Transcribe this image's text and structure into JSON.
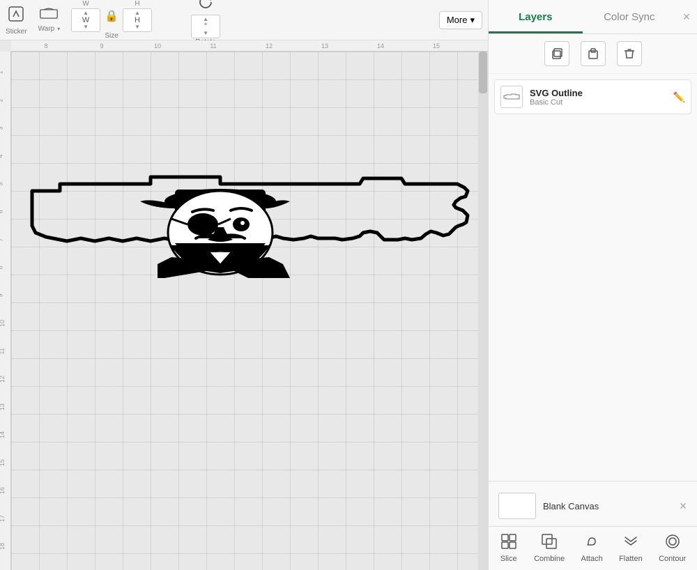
{
  "toolbar": {
    "sticker_label": "Sticker",
    "warp_label": "Warp",
    "size_label": "Size",
    "rotate_label": "Rotate",
    "more_label": "More",
    "more_arrow": "▾",
    "width_value": "W",
    "height_value": "H"
  },
  "right_panel": {
    "tabs": [
      {
        "id": "layers",
        "label": "Layers",
        "active": true
      },
      {
        "id": "color_sync",
        "label": "Color Sync",
        "active": false
      }
    ],
    "panel_icons": [
      {
        "id": "copy-icon",
        "symbol": "⧉"
      },
      {
        "id": "paste-icon",
        "symbol": "📋"
      },
      {
        "id": "delete-icon",
        "symbol": "🗑"
      }
    ],
    "layers": [
      {
        "id": "svg-outline",
        "name": "SVG Outline",
        "type": "Basic Cut",
        "icon": "✏️"
      }
    ],
    "blank_canvas_label": "Blank Canvas",
    "bottom_tools": [
      {
        "id": "slice",
        "label": "Slice",
        "symbol": "⧉"
      },
      {
        "id": "combine",
        "label": "Combine",
        "symbol": "⊕"
      },
      {
        "id": "attach",
        "label": "Attach",
        "symbol": "🔗"
      },
      {
        "id": "flatten",
        "label": "Flatten",
        "symbol": "⬇"
      },
      {
        "id": "contour",
        "label": "Contour",
        "symbol": "◎"
      }
    ]
  },
  "ruler": {
    "marks_h": [
      "8",
      "9",
      "10",
      "11",
      "12",
      "13",
      "14",
      "15"
    ],
    "marks_v": [
      "1",
      "2",
      "3",
      "4",
      "5",
      "6",
      "7",
      "8",
      "9",
      "10",
      "11",
      "12",
      "13",
      "14",
      "15",
      "16",
      "17",
      "18"
    ]
  },
  "colors": {
    "accent": "#1a7a4a",
    "border": "#dddddd",
    "bg_canvas": "#e8e8e8",
    "bg_panel": "#f9f9f9",
    "bg_toolbar": "#f5f5f5"
  }
}
